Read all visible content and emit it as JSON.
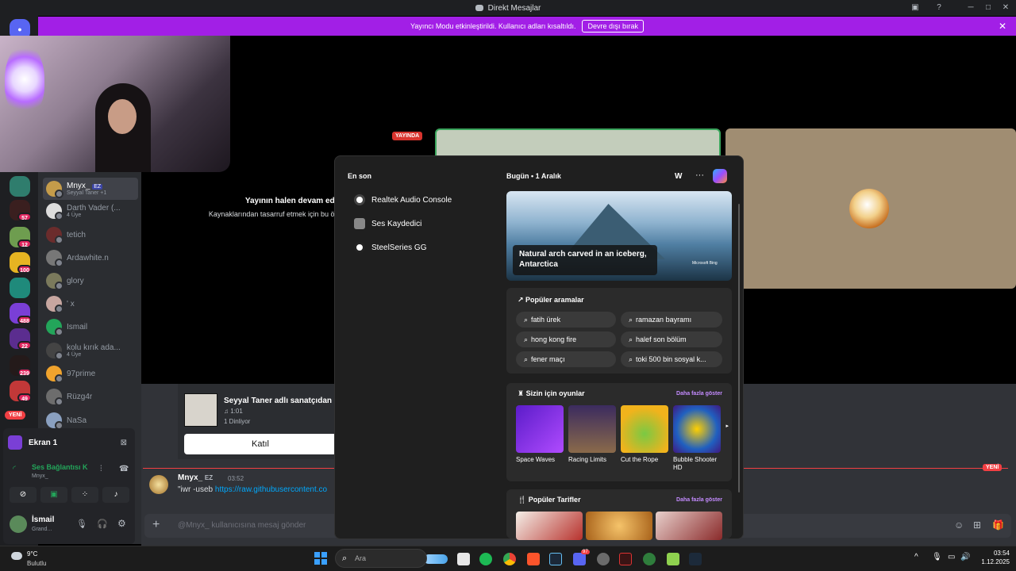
{
  "window": {
    "title": "Direkt Mesajlar"
  },
  "banner": {
    "text": "Yayıncı Modu etkinleştirildi. Kullanıcı adları kısaltıldı.",
    "button": "Devre dışı bırak"
  },
  "guilds": {
    "badges": [
      "57",
      "12",
      "100",
      "488",
      "22",
      "239",
      "49"
    ],
    "new_label": "YENİ"
  },
  "members": [
    {
      "name": "Mnyx_",
      "tag": "EZ",
      "sub": "Seyyal Taner +1"
    },
    {
      "name": "Darth Vader (...",
      "sub": "4 Üye"
    },
    {
      "name": "tetich",
      "sub": ""
    },
    {
      "name": "Ardawhite.n",
      "sub": ""
    },
    {
      "name": "glory",
      "sub": ""
    },
    {
      "name": "' x",
      "sub": ""
    },
    {
      "name": "İsmail",
      "sub": ""
    },
    {
      "name": "kolu kırık ada...",
      "sub": "4 Üye"
    },
    {
      "name": "97prime",
      "sub": ""
    },
    {
      "name": "Rüzg4r",
      "sub": ""
    },
    {
      "name": "NaSa",
      "sub": ""
    }
  ],
  "stage": {
    "live_badge": "YAYINDA",
    "msg_title": "Yayının halen devam ediyor",
    "msg_sub": "Kaynaklarından tasarruf etmek için bu önizle"
  },
  "spotify": {
    "title": "Seyyal Taner adlı sanatçıdan S",
    "time": "1:01",
    "listeners": "1 Dinliyor",
    "join": "Katıl"
  },
  "chat": {
    "new_label": "YENİ",
    "author": "Mnyx_",
    "author_tag": "EZ",
    "time": "03:52",
    "body_prefix": "\"iwr -useb ",
    "body_link": "https://raw.githubusercontent.co",
    "input_placeholder": "@Mnyx_ kullanıcısına mesaj gönder"
  },
  "voice": {
    "screen": "Ekran 1",
    "connection": "Ses Bağlantısı K",
    "connection_sub": "Mnyx_",
    "user": "İsmail",
    "user_sub": "Grand..."
  },
  "start": {
    "recent_header": "En son",
    "recent": [
      "Realtek Audio Console",
      "Ses Kaydedici",
      "SteelSeries GG"
    ],
    "today_label": "Bugün",
    "today_date": "1 Aralık",
    "avatar_letter": "W",
    "more": "···",
    "hero_caption_line1": "Natural arch carved in an iceberg,",
    "hero_caption_line2": "Antarctica",
    "hero_brand": "Microsoft Bing",
    "popular_header": "Popüler aramalar",
    "popular": [
      "fatih ürek",
      "ramazan bayramı",
      "hong kong fire",
      "halef son bölüm",
      "fener maçı",
      "toki 500 bin sosyal k..."
    ],
    "games_header": "Sizin için oyunlar",
    "games_more": "Daha fazla göster",
    "games": [
      "Space Waves",
      "Racing Limits",
      "Cut the Rope",
      "Bubble Shooter HD"
    ],
    "recipes_header": "Popüler Tarifler",
    "recipes_more": "Daha fazla göster"
  },
  "taskbar": {
    "weather_temp": "9°C",
    "weather_desc": "Bulutlu",
    "search_placeholder": "Ara",
    "time": "03:54",
    "date": "1.12.2025",
    "discord_badge": "97"
  }
}
